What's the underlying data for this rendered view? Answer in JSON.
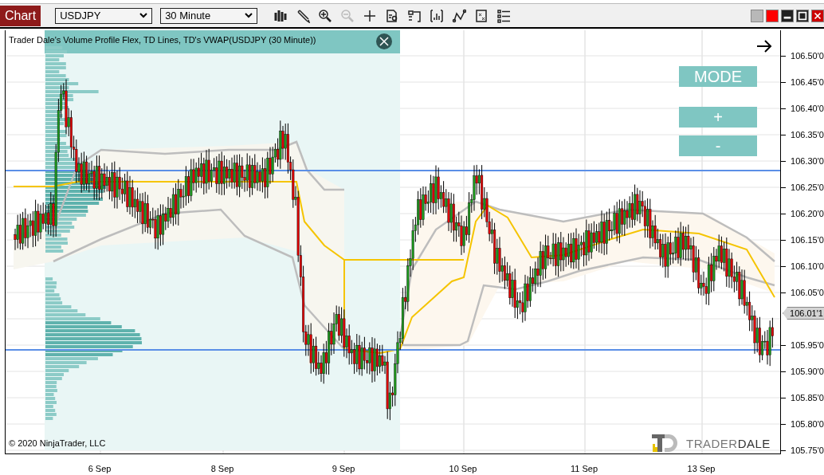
{
  "toolbar": {
    "tab": {
      "label": "Chart"
    },
    "instrument": {
      "value": "USDJPY"
    },
    "interval": {
      "value": "30 Minute"
    }
  },
  "chart": {
    "legend": "Trader Dale's Volume Profile Flex, TD Lines, TD's VWAP(USDJPY (30 Minute))",
    "buttons": [
      {
        "label": "MODE"
      },
      {
        "label": "+"
      },
      {
        "label": "-"
      }
    ],
    "copyright": "© 2020 NinjaTrader, LLC",
    "logo": "TRADER**DALE**"
  },
  "price_axis": {
    "labels": [
      "106.50'0",
      "106.45'0",
      "106.40'0",
      "106.35'0",
      "106.30'0",
      "106.25'0",
      "106.20'0",
      "106.15'0",
      "106.10'0",
      "106.05'0",
      {
        "kind": "current",
        "text": "106.01'1"
      },
      "105.95'0",
      "105.90'0",
      "105.85'0",
      "105.80'0",
      "105.75'0"
    ]
  },
  "time_axis": {
    "labels": [
      "6 Sep",
      "8 Sep",
      "9 Sep",
      "10 Sep",
      "11 Sep",
      "13 Sep"
    ]
  }
}
